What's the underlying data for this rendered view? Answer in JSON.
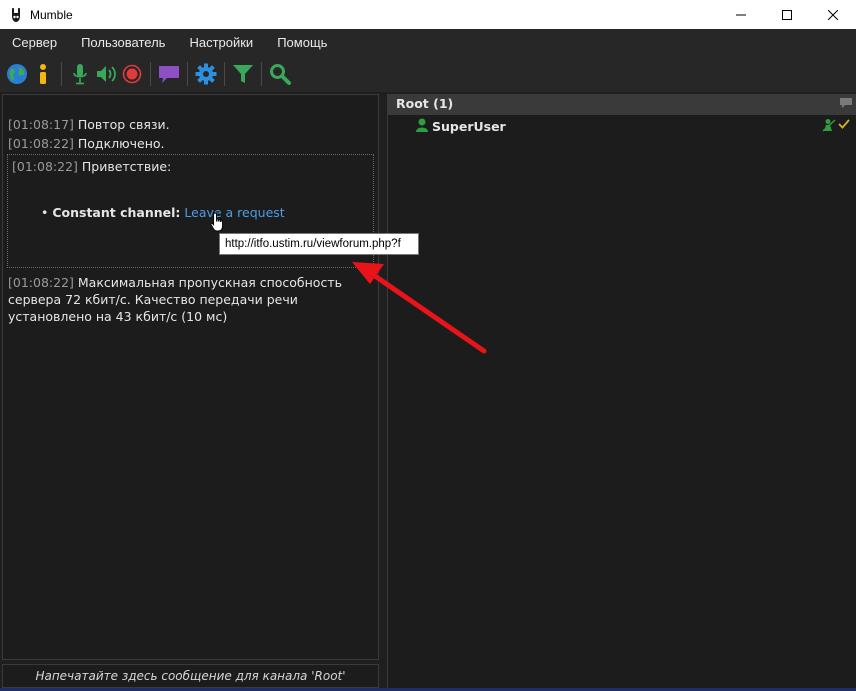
{
  "window": {
    "title": "Mumble"
  },
  "menu": {
    "items": [
      "Сервер",
      "Пользователь",
      "Настройки",
      "Помощь"
    ]
  },
  "toolbar": {
    "icons": [
      "globe-icon",
      "info-icon",
      "microphone-icon",
      "speaker-icon",
      "record-icon",
      "chat-icon",
      "settings-icon",
      "filter-icon",
      "search-icon"
    ]
  },
  "log": {
    "l1_ts": "[01:08:17]",
    "l1_text": " Повтор связи.",
    "l2_ts": "[01:08:22]",
    "l2_text": " Подключено.",
    "l3_ts": "[01:08:22]",
    "l3_text": " Приветствие:",
    "bullet_label": "Constant channel:",
    "bullet_link": "Leave a request",
    "l4_ts": "[01:08:22]",
    "l4_text": " Максимальная пропускная способность сервера 72 кбит/с. Качество передачи речи установлено на 43 кбит/с (10 мс)"
  },
  "tooltip": {
    "text": "http://itfo.ustim.ru/viewforum.php?f"
  },
  "input": {
    "placeholder": "Напечатайте здесь сообщение для канала 'Root'"
  },
  "tree": {
    "root_label": "Root (1)",
    "user_name": "SuperUser"
  },
  "colors": {
    "background": "#1f1f1f",
    "link": "#4a9ee6",
    "arrow": "#e8141a",
    "user_green": "#2e9e3e"
  }
}
